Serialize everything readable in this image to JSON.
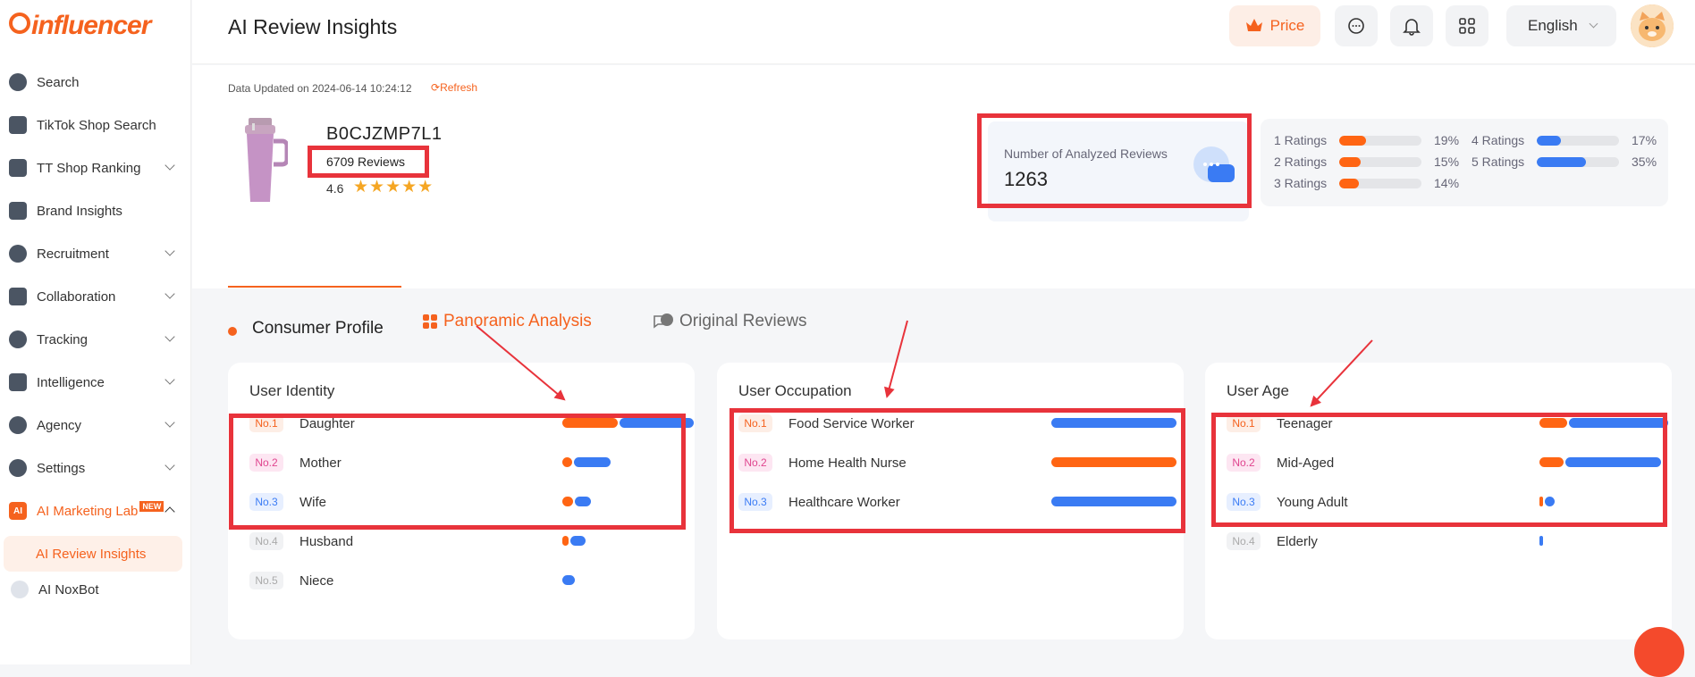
{
  "app": {
    "logo": "influencer"
  },
  "sidebar": {
    "items": [
      {
        "label": "Search",
        "icon": "compass-icon",
        "chevron": false
      },
      {
        "label": "TikTok Shop Search",
        "icon": "tiktok-shop-icon",
        "chevron": false
      },
      {
        "label": "TT Shop Ranking",
        "icon": "bar-chart-icon",
        "chevron": true
      },
      {
        "label": "Brand Insights",
        "icon": "brand-icon",
        "chevron": false
      },
      {
        "label": "Recruitment",
        "icon": "people-icon",
        "chevron": true
      },
      {
        "label": "Collaboration",
        "icon": "doc-icon",
        "chevron": true
      },
      {
        "label": "Tracking",
        "icon": "target-icon",
        "chevron": true
      },
      {
        "label": "Intelligence",
        "icon": "pulse-icon",
        "chevron": true
      },
      {
        "label": "Agency",
        "icon": "agent-icon",
        "chevron": true
      },
      {
        "label": "Settings",
        "icon": "gear-icon",
        "chevron": true
      }
    ],
    "lab": {
      "label": "AI Marketing Lab",
      "badge": "NEW",
      "icon_text": "AI"
    },
    "sub_active": "AI Review Insights",
    "noxbot": "AI NoxBot"
  },
  "header": {
    "title": "AI Review Insights",
    "price_label": "Price",
    "language": "English"
  },
  "meta": {
    "updated_label": "Data Updated on",
    "updated_value": "2024-06-14 10:24:12",
    "refresh_label": "Refresh"
  },
  "product": {
    "asin": "B0CJZMP7L1",
    "reviews": "6709 Reviews",
    "rating": "4.6",
    "stars": "★★★★★"
  },
  "analyzed": {
    "label": "Number of Analyzed Reviews",
    "value": "1263"
  },
  "ratings": [
    {
      "label": "1 Ratings",
      "pct": "19%",
      "value": 0.19,
      "color": "#ff6513"
    },
    {
      "label": "2 Ratings",
      "pct": "15%",
      "value": 0.15,
      "color": "#ff6513"
    },
    {
      "label": "3 Ratings",
      "pct": "14%",
      "value": 0.14,
      "color": "#ff6513"
    },
    {
      "label": "4 Ratings",
      "pct": "17%",
      "value": 0.17,
      "color": "#3a7bf3"
    },
    {
      "label": "5 Ratings",
      "pct": "35%",
      "value": 0.35,
      "color": "#3a7bf3"
    }
  ],
  "tabs": {
    "panoramic": "Panoramic Analysis",
    "original": "Original Reviews"
  },
  "section": {
    "consumer_profile": "Consumer Profile"
  },
  "cards": [
    {
      "title": "User Identity",
      "rows": [
        {
          "rank": "No.1",
          "name": "Daughter",
          "neg": 0.43,
          "pos": 0.57
        },
        {
          "rank": "No.2",
          "name": "Mother",
          "neg": 0.22,
          "pos": 0.78
        },
        {
          "rank": "No.3",
          "name": "Wife",
          "neg": 0.4,
          "pos": 0.6
        },
        {
          "rank": "No.4",
          "name": "Husband",
          "neg": 0.3,
          "pos": 0.7
        },
        {
          "rank": "No.5",
          "name": "Niece",
          "neg": 0,
          "pos": 1
        }
      ]
    },
    {
      "title": "User Occupation",
      "rows": [
        {
          "rank": "No.1",
          "name": "Food Service Worker",
          "neg": 0,
          "pos": 1
        },
        {
          "rank": "No.2",
          "name": "Home Health Nurse",
          "neg": 1,
          "pos": 0
        },
        {
          "rank": "No.3",
          "name": "Healthcare Worker",
          "neg": 0,
          "pos": 1
        }
      ]
    },
    {
      "title": "User Age",
      "rows": [
        {
          "rank": "No.1",
          "name": "Teenager",
          "neg": 0.22,
          "pos": 0.78
        },
        {
          "rank": "No.2",
          "name": "Mid-Aged",
          "neg": 0.2,
          "pos": 0.8
        },
        {
          "rank": "No.3",
          "name": "Young Adult",
          "neg": 0.2,
          "pos": 0.8
        },
        {
          "rank": "No.4",
          "name": "Elderly",
          "neg": 0,
          "pos": 1
        }
      ]
    }
  ],
  "colors": {
    "accent": "#f5621e",
    "negative": "#ff6513",
    "positive": "#3a7bf3",
    "highlight": "#e8333b"
  }
}
